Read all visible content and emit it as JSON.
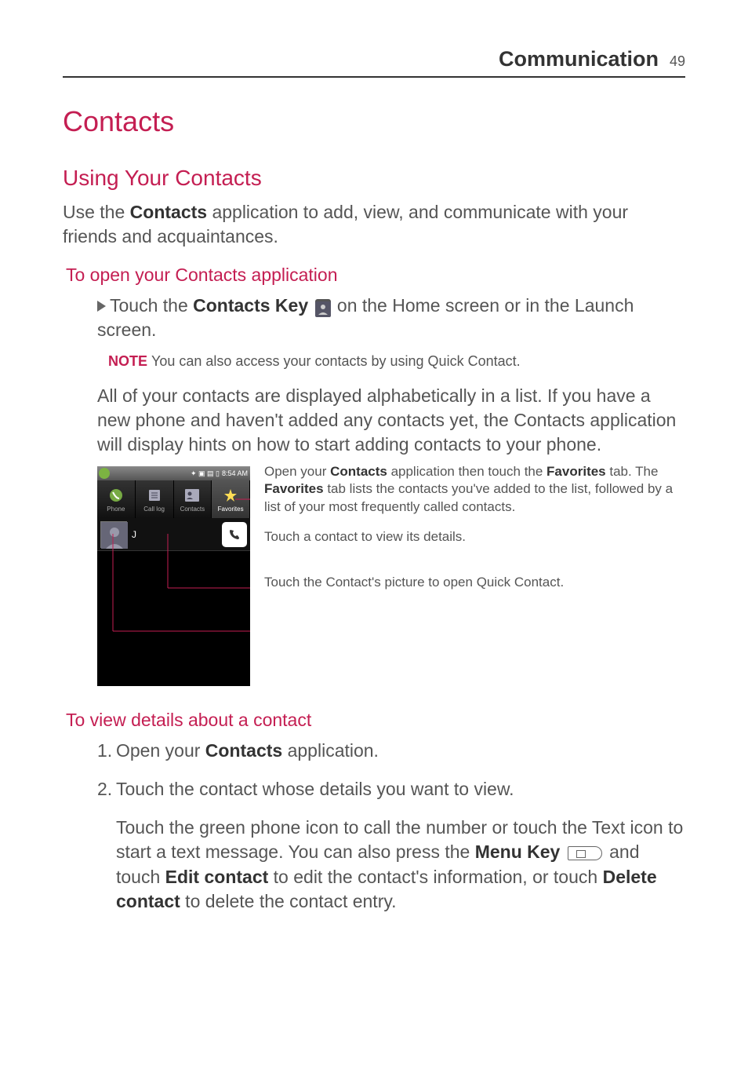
{
  "header": {
    "section": "Communication",
    "page": "49"
  },
  "h1": "Contacts",
  "using": {
    "title": "Using Your Contacts",
    "intro_a": "Use the ",
    "intro_bold": "Contacts",
    "intro_b": " application to add, view, and communicate with your friends and acquaintances."
  },
  "open": {
    "title": "To open your Contacts application",
    "bullet_a": "Touch the ",
    "bullet_bold": "Contacts Key",
    "bullet_b": " on the Home screen or in the Launch screen.",
    "note_label": "NOTE",
    "note_text": "You can also access your contacts by using Quick Contact.",
    "para": "All of your contacts are displayed alphabetically in a list. If you have a new phone and haven't added any contacts yet, the Contacts application will display hints on how to start adding contacts to your phone."
  },
  "phone": {
    "time": "8:54 AM",
    "tabs": [
      "Phone",
      "Call log",
      "Contacts",
      "Favorites"
    ],
    "contact_name": "J"
  },
  "callouts": {
    "c1_a": "Open your ",
    "c1_b1": "Contacts",
    "c1_c": " application then touch the ",
    "c1_b2": "Favorites",
    "c1_d": " tab. The ",
    "c1_b3": "Favorites",
    "c1_e": " tab lists the contacts you've added to the list, followed by a list of your most frequently called contacts.",
    "c2": "Touch a contact to view its details.",
    "c3": "Touch the Contact's picture to open Quick Contact."
  },
  "view": {
    "title": "To view details about a contact",
    "step1_a": "Open your ",
    "step1_bold": "Contacts",
    "step1_b": " application.",
    "step2": "Touch the contact whose details you want to view.",
    "para_a": "Touch the green phone icon to call the number or touch the Text icon to start a text message. You can also press the ",
    "para_b1": "Menu Key",
    "para_b": " and touch ",
    "para_b2": "Edit contact",
    "para_c": " to edit the contact's information, or touch ",
    "para_b3": "Delete contact",
    "para_d": " to delete the contact entry."
  }
}
